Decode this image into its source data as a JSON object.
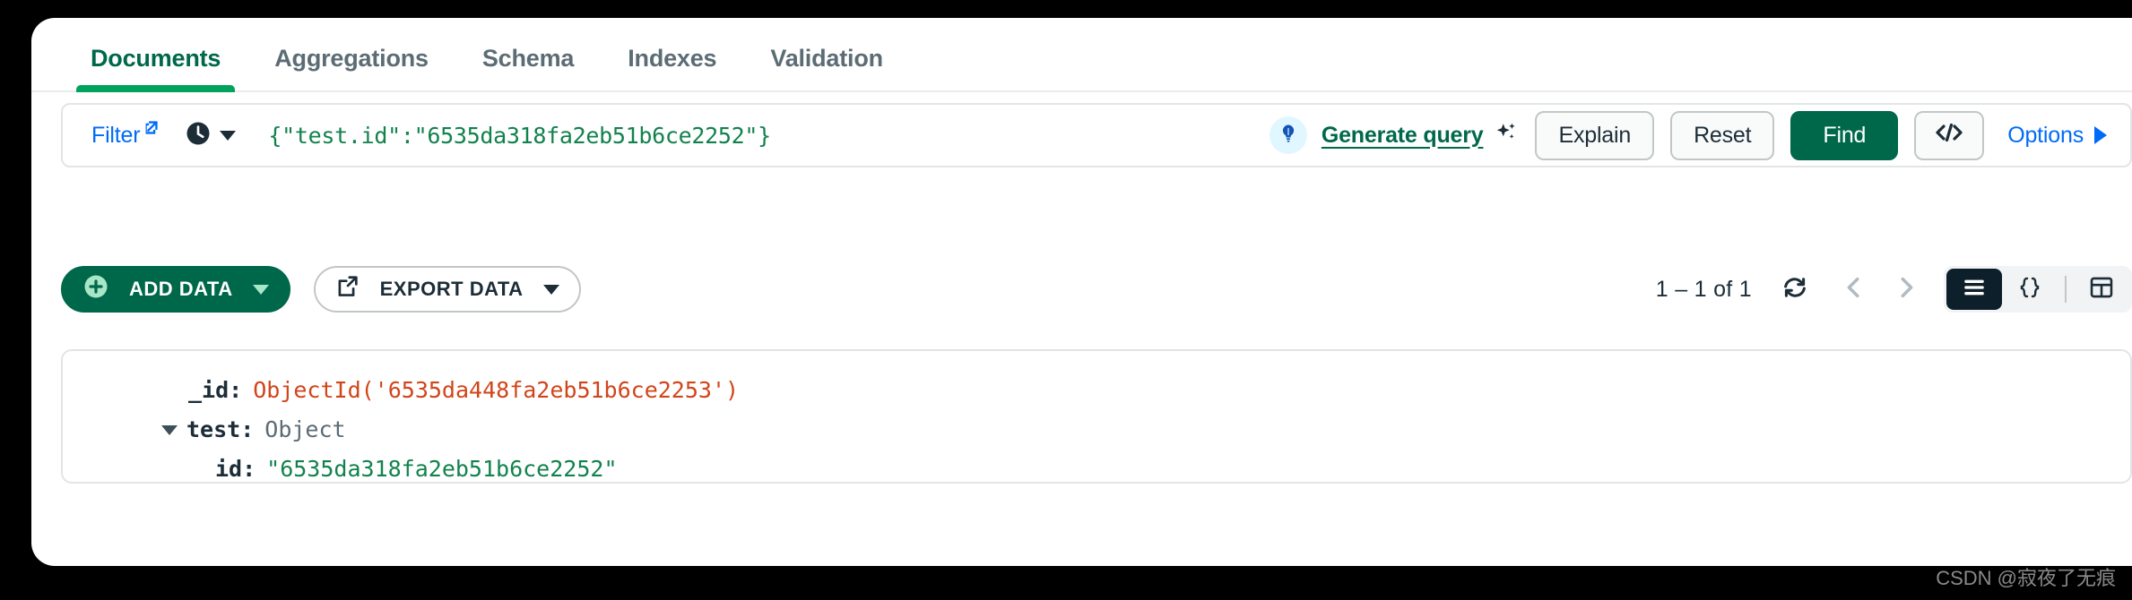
{
  "tabs": [
    {
      "label": "Documents",
      "active": true
    },
    {
      "label": "Aggregations",
      "active": false
    },
    {
      "label": "Schema",
      "active": false
    },
    {
      "label": "Indexes",
      "active": false
    },
    {
      "label": "Validation",
      "active": false
    }
  ],
  "query_bar": {
    "filter_label": "Filter",
    "filter_icon": "external-link-icon",
    "history_icon": "clock-icon",
    "query_value": "{\"test.id\":\"6535da318fa2eb51b6ce2252\"}",
    "bulb_icon": "lightbulb-icon",
    "generate_query_label": "Generate query",
    "sparkle_icon": "sparkle-icon",
    "explain_label": "Explain",
    "reset_label": "Reset",
    "find_label": "Find",
    "code_icon": "code-brackets-icon",
    "options_label": "Options",
    "options_caret": "caret-right-icon"
  },
  "toolbar": {
    "add_data_label": "ADD DATA",
    "add_data_icon": "plus-circle-icon",
    "export_data_label": "EXPORT DATA",
    "export_data_icon": "export-icon",
    "count_label": "1 – 1 of 1",
    "refresh_icon": "refresh-icon",
    "prev_icon": "chevron-left-icon",
    "next_icon": "chevron-right-icon",
    "view_list_icon": "list-view-icon",
    "view_json_icon": "json-view-icon",
    "view_table_icon": "table-view-icon"
  },
  "document": {
    "field_id_key": "_id:",
    "field_id_value": "ObjectId('6535da448fa2eb51b6ce2253')",
    "field_test_key": "test:",
    "field_test_type": "Object",
    "field_nested_id_key": "id:",
    "field_nested_id_value": "\"6535da318fa2eb51b6ce2252\""
  },
  "watermark": "CSDN @寂夜了无痕",
  "colors": {
    "brand_green": "#00684a",
    "accent_green": "#00a35c",
    "link_blue": "#016bf8",
    "string_green": "#12824d",
    "objectid_red": "#d1451a",
    "dark_navy": "#0d1f2b"
  }
}
